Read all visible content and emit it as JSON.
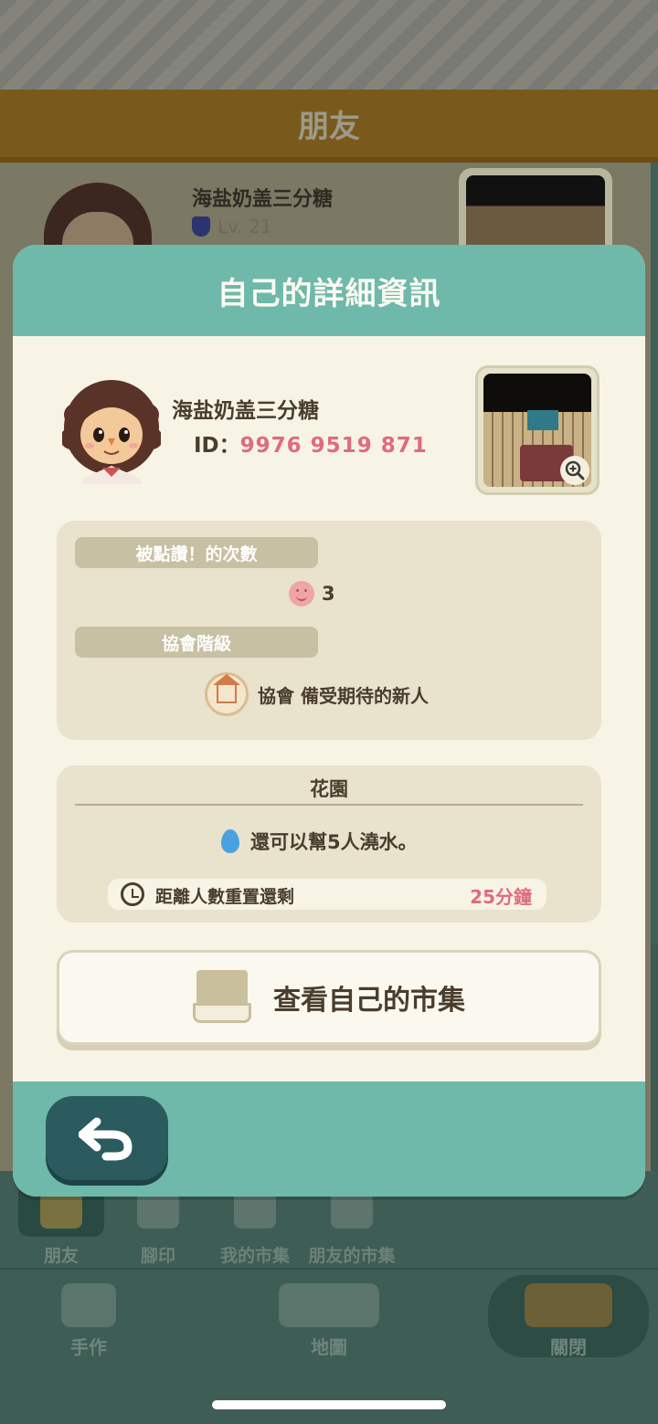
{
  "background": {
    "title": "朋友",
    "friend": {
      "name": "海盐奶盖三分糖",
      "level": "Lv. 21"
    },
    "tabs": [
      {
        "label": "朋友",
        "active": true
      },
      {
        "label": "腳印",
        "active": false
      },
      {
        "label": "我的市集",
        "active": false
      },
      {
        "label": "朋友的市集",
        "active": false
      }
    ],
    "nav": {
      "craft": "手作",
      "map": "地圖",
      "close": "關閉"
    }
  },
  "dialog": {
    "title": "自己的詳細資訊",
    "profile": {
      "name": "海盐奶盖三分糖",
      "id_label": "ID：",
      "id_value": "9976 9519 871"
    },
    "stats": {
      "likes_label": "被點讚！的次數",
      "likes_count": "3",
      "rank_label": "協會階級",
      "rank_value": "協會 備受期待的新人"
    },
    "garden": {
      "title": "花園",
      "water_text": "還可以幫5人澆水。",
      "reset_label": "距離人數重置還剩",
      "reset_value": "25分鐘"
    },
    "market_button": "查看自己的市集"
  },
  "colors": {
    "accent_teal": "#6fb9aa",
    "highlight_pink": "#e06b7e",
    "text_brown": "#4a3d2d"
  }
}
